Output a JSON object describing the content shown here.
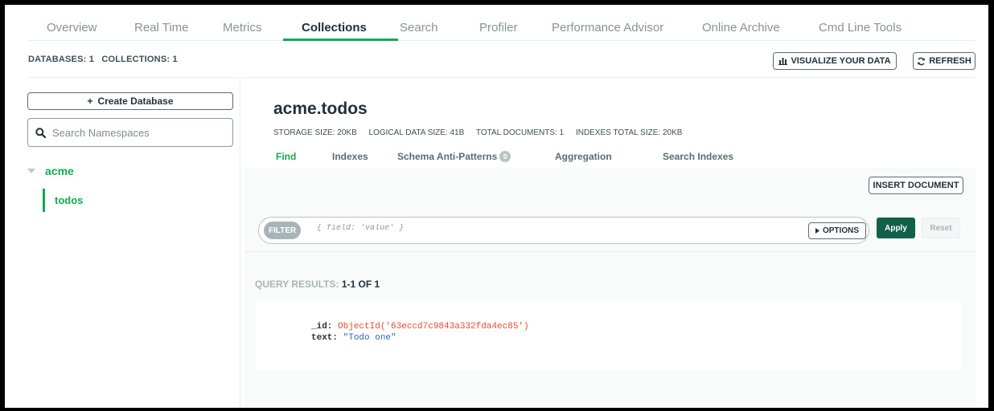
{
  "nav": {
    "tabs": [
      {
        "label": "Overview"
      },
      {
        "label": "Real Time"
      },
      {
        "label": "Metrics"
      },
      {
        "label": "Collections"
      },
      {
        "label": "Search"
      },
      {
        "label": "Profiler"
      },
      {
        "label": "Performance Advisor"
      },
      {
        "label": "Online Archive"
      },
      {
        "label": "Cmd Line Tools"
      }
    ],
    "active": "Collections"
  },
  "counts": {
    "databases": "DATABASES: 1",
    "collections": "COLLECTIONS: 1"
  },
  "toolbar": {
    "visualize_label": "VISUALIZE YOUR DATA",
    "refresh_label": "REFRESH"
  },
  "sidebar": {
    "create_db_label": "Create Database",
    "search_placeholder": "Search Namespaces",
    "database": "acme",
    "collection": "todos"
  },
  "namespace": {
    "title": "acme.todos",
    "storage_size": "STORAGE SIZE: 20KB",
    "logical_size": "LOGICAL DATA SIZE: 41B",
    "total_documents": "TOTAL DOCUMENTS: 1",
    "indexes_size": "INDEXES TOTAL SIZE: 20KB"
  },
  "sub_tabs": {
    "find": "Find",
    "indexes": "Indexes",
    "schema": "Schema Anti-Patterns",
    "schema_badge": "0",
    "aggregation": "Aggregation",
    "search_indexes": "Search Indexes"
  },
  "find": {
    "insert_label": "INSERT DOCUMENT",
    "filter_pill": "FILTER",
    "filter_placeholder": "{ field: 'value' }",
    "options_label": "OPTIONS",
    "apply_label": "Apply",
    "reset_label": "Reset",
    "results_prefix": "QUERY RESULTS:",
    "results_count": "1-1 OF 1"
  },
  "document": {
    "id_key": "_id:",
    "id_value": "ObjectId('63eccd7c9843a332fda4ec85')",
    "text_key": "text:",
    "text_value": "\"Todo one\""
  },
  "colors": {
    "accent_green": "#13aa52",
    "apply_green": "#116149",
    "oid_red": "#e84c2c",
    "string_blue": "#2f6eb8"
  }
}
